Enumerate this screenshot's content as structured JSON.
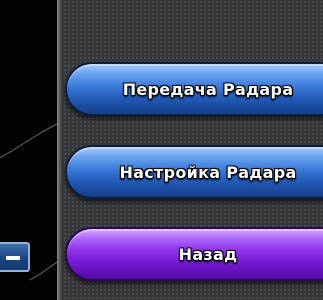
{
  "menu": {
    "buttons": [
      {
        "label": "Передача Радара",
        "color": "#2a63c4"
      },
      {
        "label": "Настройка Радара",
        "color": "#2a63c4"
      },
      {
        "label": "Назад",
        "color": "#8a2be2"
      }
    ]
  },
  "radar": {
    "range_button_icon": "minus-icon"
  },
  "colors": {
    "panel_background": "#36373a",
    "radar_background": "#020202"
  }
}
